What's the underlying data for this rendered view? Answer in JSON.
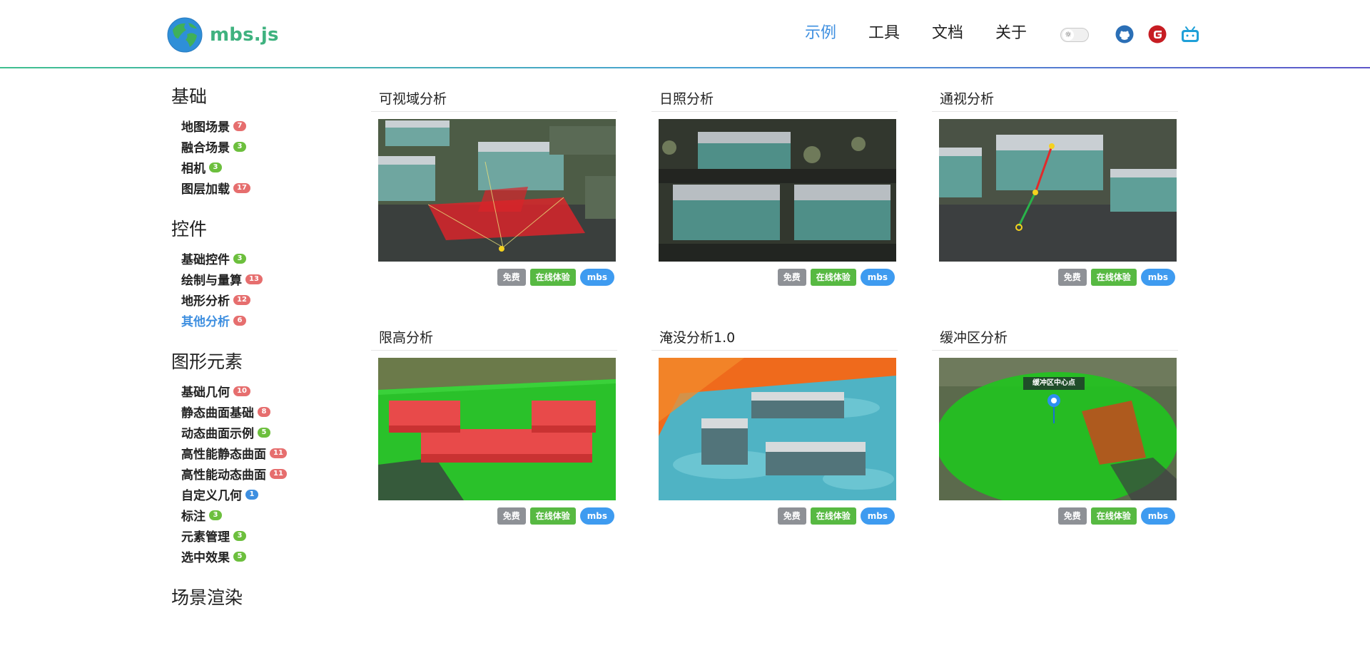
{
  "brand": {
    "name": "mbs.js"
  },
  "nav": {
    "items": [
      {
        "label": "示例",
        "active": true
      },
      {
        "label": "工具",
        "active": false
      },
      {
        "label": "文档",
        "active": false
      },
      {
        "label": "关于",
        "active": false
      }
    ],
    "theme_icon": "sun-icon",
    "social": [
      "github-icon",
      "gitee-icon",
      "bilibili-icon"
    ]
  },
  "colors": {
    "accent": "#3e8fe0",
    "brand": "#3fb27f",
    "badge_red": "#e66e6e",
    "badge_green": "#6cbf3d",
    "badge_blue": "#3e8fe0",
    "tag_free": "#8e9196",
    "tag_try": "#57b942",
    "tag_mbs": "#3e9bf0"
  },
  "sidebar": {
    "sections": [
      {
        "title": "基础",
        "items": [
          {
            "label": "地图场景",
            "count": "7",
            "color": "red"
          },
          {
            "label": "融合场景",
            "count": "3",
            "color": "green"
          },
          {
            "label": "相机",
            "count": "3",
            "color": "green"
          },
          {
            "label": "图层加载",
            "count": "17",
            "color": "red"
          }
        ]
      },
      {
        "title": "控件",
        "items": [
          {
            "label": "基础控件",
            "count": "3",
            "color": "green"
          },
          {
            "label": "绘制与量算",
            "count": "13",
            "color": "red"
          },
          {
            "label": "地形分析",
            "count": "12",
            "color": "red"
          },
          {
            "label": "其他分析",
            "count": "6",
            "color": "red",
            "active": true
          }
        ]
      },
      {
        "title": "图形元素",
        "items": [
          {
            "label": "基础几何",
            "count": "10",
            "color": "red"
          },
          {
            "label": "静态曲面基础",
            "count": "8",
            "color": "red"
          },
          {
            "label": "动态曲面示例",
            "count": "5",
            "color": "green"
          },
          {
            "label": "高性能静态曲面",
            "count": "11",
            "color": "red"
          },
          {
            "label": "高性能动态曲面",
            "count": "11",
            "color": "red"
          },
          {
            "label": "自定义几何",
            "count": "1",
            "color": "blue"
          },
          {
            "label": "标注",
            "count": "3",
            "color": "green"
          },
          {
            "label": "元素管理",
            "count": "3",
            "color": "green"
          },
          {
            "label": "选中效果",
            "count": "5",
            "color": "green"
          }
        ]
      },
      {
        "title": "场景渲染",
        "items": []
      }
    ]
  },
  "cards": [
    {
      "title": "可视域分析",
      "thumb": "viewshed",
      "tags": [
        "免费",
        "在线体验",
        "mbs"
      ]
    },
    {
      "title": "日照分析",
      "thumb": "sunlight",
      "tags": [
        "免费",
        "在线体验",
        "mbs"
      ]
    },
    {
      "title": "通视分析",
      "thumb": "sightline",
      "tags": [
        "免费",
        "在线体验",
        "mbs"
      ]
    },
    {
      "title": "限高分析",
      "thumb": "heightlimit",
      "tags": [
        "免费",
        "在线体验",
        "mbs"
      ]
    },
    {
      "title": "淹没分析1.0",
      "thumb": "flood",
      "tags": [
        "免费",
        "在线体验",
        "mbs"
      ]
    },
    {
      "title": "缓冲区分析",
      "thumb": "buffer",
      "tags": [
        "免费",
        "在线体验",
        "mbs"
      ],
      "overlay_label": "缓冲区中心点"
    }
  ]
}
